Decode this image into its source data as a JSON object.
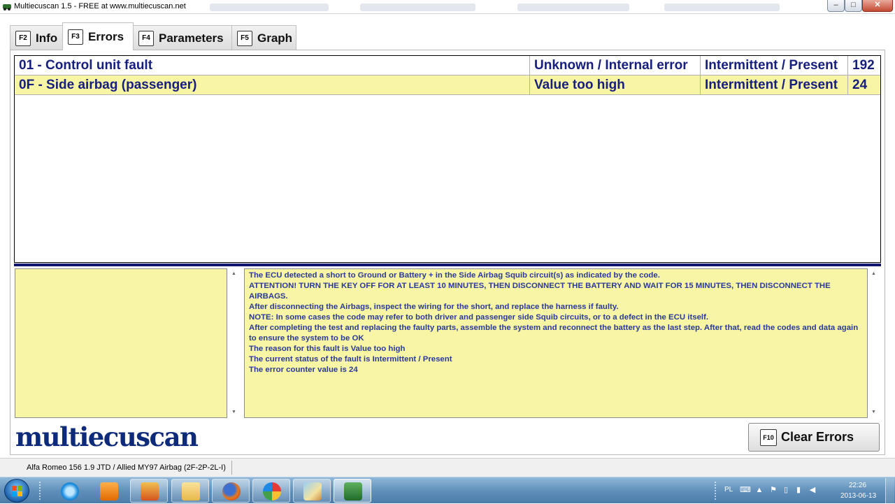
{
  "window": {
    "title": "Multiecuscan 1.5 - FREE at www.multiecuscan.net",
    "minimize": "–",
    "maximize": "□",
    "close": "✕"
  },
  "tabs": [
    {
      "key": "F2",
      "label": "Info"
    },
    {
      "key": "F3",
      "label": "Errors"
    },
    {
      "key": "F4",
      "label": "Parameters"
    },
    {
      "key": "F5",
      "label": "Graph"
    }
  ],
  "errors": [
    {
      "code": "01 - Control unit fault",
      "type": "Unknown / Internal error",
      "status": "Intermittent / Present",
      "count": "192"
    },
    {
      "code": "0F - Side airbag (passenger)",
      "type": "Value too high",
      "status": "Intermittent / Present",
      "count": "24"
    }
  ],
  "description": [
    "The ECU detected a short to Ground or Battery + in the Side Airbag Squib circuit(s) as indicated by the code.",
    "ATTENTION! TURN THE KEY OFF FOR AT LEAST 10 MINUTES, THEN DISCONNECT THE BATTERY AND WAIT FOR 15 MINUTES, THEN DISCONNECT THE AIRBAGS.",
    "After disconnecting the Airbags, inspect the wiring for the short, and replace the harness if faulty.",
    "NOTE: In some cases the code may refer to both driver and passenger side Squib circuits, or to a defect in the ECU itself.",
    "After completing the test and replacing the faulty parts, assemble the system and reconnect the battery as the last step. After that, read the codes and data again to ensure the system to be OK",
    "The reason for this fault is Value too high",
    "The current status of the fault is Intermittent / Present",
    "The error counter value is 24"
  ],
  "logo": "multiecuscan",
  "clear_button": {
    "key": "F10",
    "label": "Clear Errors"
  },
  "status": "Alfa Romeo 156 1.9 JTD / Allied MY97 Airbag (2F-2P-2L-I)",
  "taskbar": {
    "language": "PL",
    "time": "22:26",
    "date": "2013-06-13"
  },
  "colors": {
    "highlight": "#f8f5a4",
    "text_blue": "#161e7e",
    "divider": "#0e1670"
  }
}
